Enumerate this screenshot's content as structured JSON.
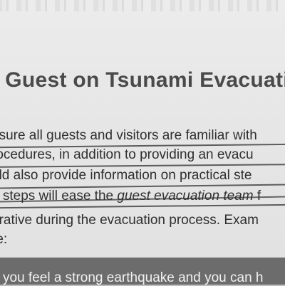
{
  "document": {
    "title": "or Guest on Tsunami Evacuati",
    "lines": [
      "nsure all guests and visitors are familiar with",
      "rocedures, in addition to providing an evacu",
      "uld also provide information on practical ste",
      "e steps will ease the ",
      "erative during the evacuation process. Exam",
      "re:"
    ],
    "line4_italic": "guest evacuation team",
    "line4_tail": " f",
    "footer_line": "you feel a strong earthquake and you can h"
  }
}
